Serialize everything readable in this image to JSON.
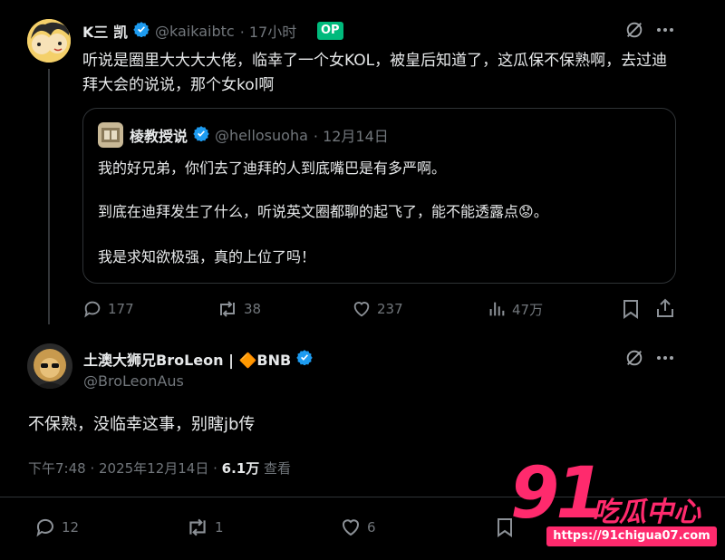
{
  "post1": {
    "display_name": "K三 凯",
    "handle": "@kaikaibtc",
    "time": "· 17小时",
    "op_badge": "OP",
    "text": "听说是圈里大大大大佬，临幸了一个女KOL，被皇后知道了，这瓜保不保熟啊，去过迪拜大会的说说，那个女kol啊",
    "quote": {
      "display_name": "棱教授说",
      "handle": "@hellosuoha",
      "time": "· 12月14日",
      "para1": "我的好兄弟，你们去了迪拜的人到底嘴巴是有多严啊。",
      "para2": "到底在迪拜发生了什么，听说英文圈都聊的起飞了，能不能透露点",
      "para2_emoji": "😟",
      "para2_end": "。",
      "para3": "我是求知欲极强，真的上位了吗！"
    },
    "actions": {
      "replies": "177",
      "reposts": "38",
      "likes": "237",
      "views": "47万"
    }
  },
  "post2": {
    "display_name": "土澳大狮兄BroLeon | 🔶BNB",
    "handle": "@BroLeonAus",
    "text": "不保熟，没临幸这事，别瞎jb传",
    "meta_time": "下午7:48 · 2025年12月14日 · ",
    "meta_views_count": "6.1万",
    "meta_views_label": " 查看",
    "actions": {
      "replies": "12",
      "reposts": "1",
      "likes": "6"
    }
  },
  "watermark": {
    "big": "91",
    "site_name": "吃瓜中心",
    "url": "https://91chigua07.com"
  },
  "colors": {
    "background": "#000000",
    "text": "#e7e9ea",
    "muted": "#71767b",
    "verified": "#1d9bf0",
    "op_badge": "#00ba7c",
    "watermark": "#ff2a6d"
  }
}
